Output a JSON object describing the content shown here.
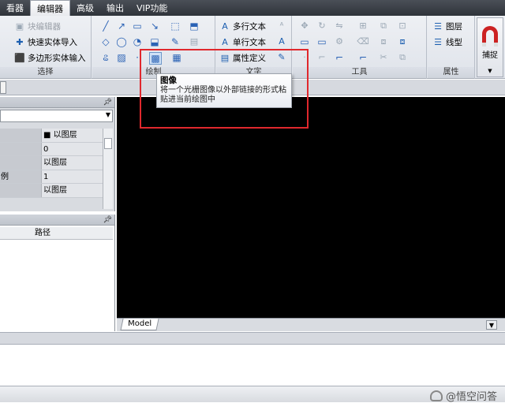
{
  "menubar": {
    "items": [
      "看器",
      "编辑器",
      "高级",
      "输出",
      "VIP功能"
    ],
    "active_index": 1
  },
  "ribbon": {
    "groups": {
      "select": {
        "label": "选择",
        "items": [
          "块编辑器",
          "快速实体导入",
          "多边形实体输入"
        ]
      },
      "draw": {
        "label": "绘制"
      },
      "text": {
        "label": "文字",
        "items": [
          "多行文本",
          "单行文本",
          "属性定义"
        ]
      },
      "tools": {
        "label": "工具"
      },
      "properties": {
        "label": "属性",
        "items": [
          "图层",
          "线型"
        ]
      }
    },
    "capture_label": "捕捉"
  },
  "tooltip": {
    "title": "图像",
    "description": "将一个光栅图像以外部链接的形式粘贴进当前绘图中"
  },
  "properties_panel": {
    "rows": [
      {
        "name": "",
        "value": "■ 以图层"
      },
      {
        "name": "",
        "value": "0"
      },
      {
        "name": "",
        "value": "以图层"
      },
      {
        "name": "例",
        "value": "1"
      },
      {
        "name": "",
        "value": "以图层"
      }
    ]
  },
  "files_panel": {
    "column_path": "路径"
  },
  "canvas": {
    "model_tab": "Model"
  },
  "watermark": "@悟空问答",
  "colors": {
    "highlight": "#e0282d",
    "canvas_bg": "#000000",
    "menubar_bg": "#3a3e45"
  }
}
